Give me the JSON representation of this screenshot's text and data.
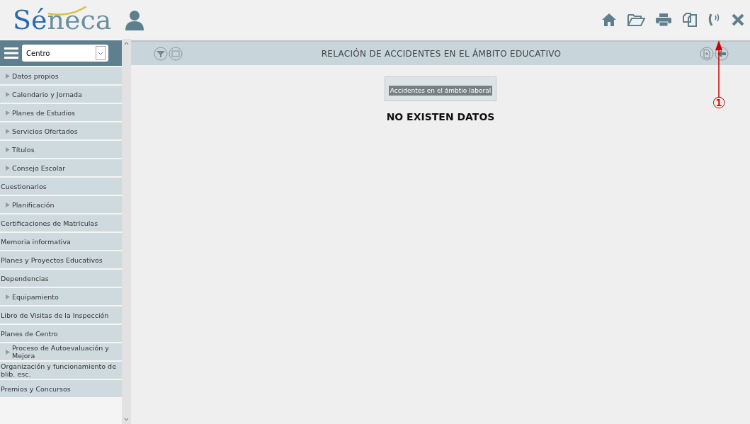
{
  "header": {
    "logo": [
      "Sé",
      "neca"
    ]
  },
  "sidebar": {
    "selector": {
      "value": "Centro"
    },
    "items": [
      {
        "label": "Datos propios",
        "kind": "group"
      },
      {
        "label": "Calendario y Jornada",
        "kind": "group"
      },
      {
        "label": "Planes de Estudios",
        "kind": "group"
      },
      {
        "label": "Servicios Ofertados",
        "kind": "group"
      },
      {
        "label": "Títulos",
        "kind": "group"
      },
      {
        "label": "Consejo Escolar",
        "kind": "group"
      },
      {
        "label": "Cuestionarios",
        "kind": "leaf"
      },
      {
        "label": "Planificación",
        "kind": "group"
      },
      {
        "label": "Certificaciones de Matrículas",
        "kind": "leaf"
      },
      {
        "label": "Memoria informativa",
        "kind": "leaf"
      },
      {
        "label": "Planes y Proyectos Educativos",
        "kind": "leaf"
      },
      {
        "label": "Dependencias",
        "kind": "leaf"
      },
      {
        "label": "Equipamiento",
        "kind": "group"
      },
      {
        "label": "Libro de Visitas de la Inspección",
        "kind": "leaf"
      },
      {
        "label": "Planes de Centro",
        "kind": "leaf"
      },
      {
        "label": "Proceso de Autoevaluación y Mejora",
        "kind": "group"
      },
      {
        "label": "Organización y funcionamiento de blib. esc.",
        "kind": "leaf"
      },
      {
        "label": "Premios y Concursos",
        "kind": "leaf"
      }
    ]
  },
  "main": {
    "title": "RELACIÓN DE ACCIDENTES EN EL ÁMBITO EDUCATIVO",
    "tab": "Accidentes en el ámbtio laboral",
    "message": "NO EXISTEN DATOS"
  },
  "annotation": {
    "label": "①"
  }
}
